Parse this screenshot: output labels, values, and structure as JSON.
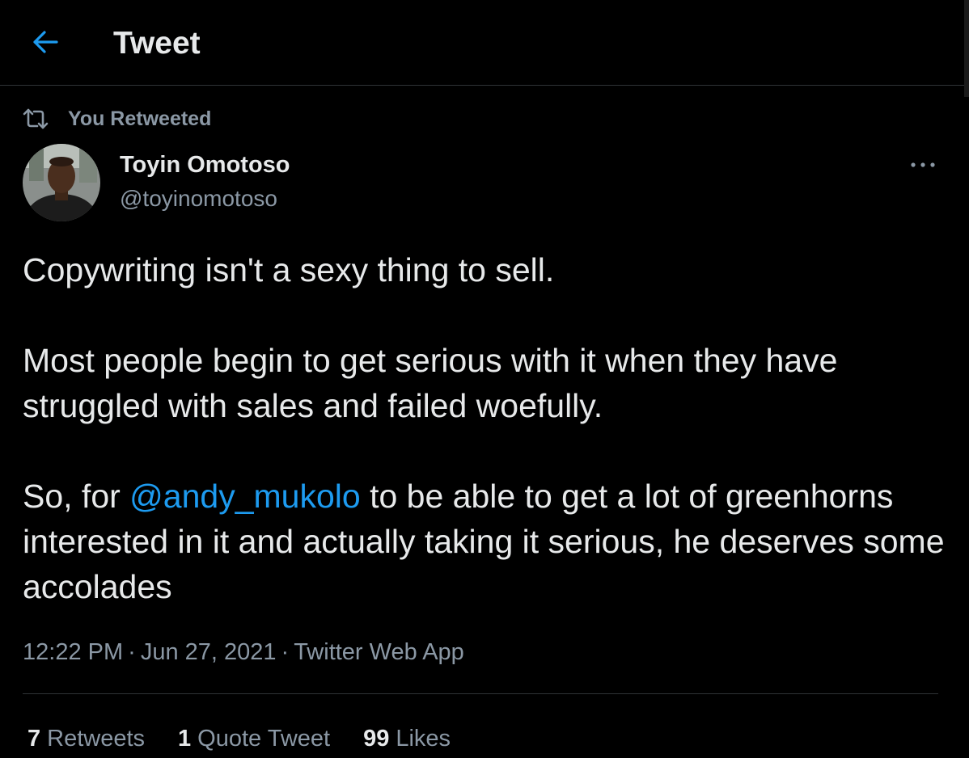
{
  "header": {
    "title": "Tweet",
    "back_icon": "arrow-left-icon"
  },
  "tweet": {
    "context_label": "You Retweeted",
    "context_icon": "retweet-icon",
    "author": {
      "name": "Toyin Omotoso",
      "handle": "@toyinomotoso"
    },
    "more_icon": "more-horizontal-icon",
    "body": {
      "p1": "Copywriting isn't a sexy thing to sell.",
      "p2": "Most people begin to get serious with it when they have struggled with sales and failed woefully.",
      "p3_before": "So, for ",
      "p3_mention": "@andy_mukolo",
      "p3_after": " to be able to get a lot of greenhorns interested in it and actually taking it serious, he deserves some accolades"
    },
    "meta": {
      "time": "12:22 PM",
      "separator": "·",
      "date": "Jun 27, 2021",
      "source": "Twitter Web App"
    },
    "stats": [
      {
        "count": "7",
        "label": "Retweets"
      },
      {
        "count": "1",
        "label": "Quote Tweet"
      },
      {
        "count": "99",
        "label": "Likes"
      }
    ]
  },
  "colors": {
    "background": "#000000",
    "primary_text": "#e7e9ea",
    "secondary_text": "#8b98a5",
    "accent": "#1d9bf0",
    "divider": "#2f3336"
  }
}
